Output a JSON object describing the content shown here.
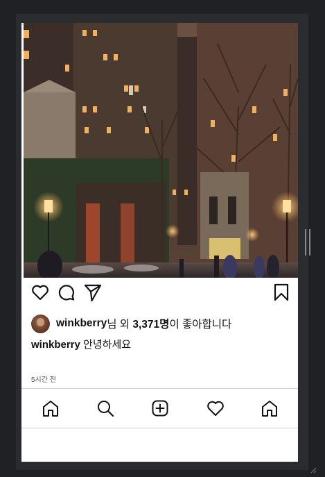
{
  "post": {
    "image_alt": "city street at night with lit buildings and bare trees",
    "liker_name": "winkberry",
    "liker_suffix": "님",
    "likes_conj": " 외 ",
    "likes_count": "3,371명",
    "likes_tail": "이 좋아합니다",
    "caption_user": "winkberry",
    "caption_text": " 안녕하세요",
    "time_ago": "5시간 전"
  },
  "actions": {
    "icons": [
      "heart-icon",
      "comment-icon",
      "send-icon",
      "bookmark-icon"
    ]
  },
  "bottom_nav": {
    "icons": [
      "home-icon",
      "search-icon",
      "add-post-icon",
      "activity-heart-icon",
      "profile-home-icon"
    ]
  },
  "colors": {
    "page_bg": "#202124",
    "panel_bg": "#2b2c30",
    "card_bg": "#ffffff",
    "text": "#111111",
    "muted": "#555555",
    "divider": "#cfcfcf"
  }
}
